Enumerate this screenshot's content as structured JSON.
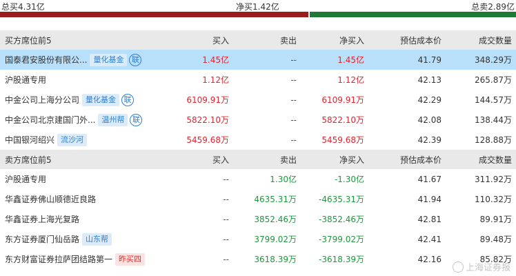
{
  "summary": {
    "total_buy": "总买4.31亿",
    "net_buy": "净买1.42亿",
    "total_sell": "总卖2.89亿",
    "buy_share": 0.598,
    "colors": {
      "buy": "#9b1c1c",
      "sell": "#1e7a36"
    }
  },
  "buy_section": {
    "headers": [
      "买方席位前5",
      "买入",
      "卖出",
      "净买入",
      "预估成本价",
      "成交数量"
    ],
    "rows": [
      {
        "name": "国泰君安股份有限公...",
        "tag": "量化基金",
        "lian": "联",
        "buy": "1.45亿",
        "sell": "--",
        "net": "1.45亿",
        "cost": "41.79",
        "volume": "348.29万"
      },
      {
        "name": "沪股通专用",
        "tag": "",
        "lian": "",
        "buy": "1.12亿",
        "sell": "--",
        "net": "1.12亿",
        "cost": "42.13",
        "volume": "265.87万"
      },
      {
        "name": "中金公司上海分公司",
        "tag": "量化基金",
        "lian": "联",
        "buy": "6109.91万",
        "sell": "--",
        "net": "6109.91万",
        "cost": "42.29",
        "volume": "144.57万"
      },
      {
        "name": "中金公司北京建国门外...",
        "tag": "温州帮",
        "lian": "联",
        "buy": "5822.10万",
        "sell": "--",
        "net": "5822.10万",
        "cost": "42.08",
        "volume": "138.44万"
      },
      {
        "name": "中国银河绍兴",
        "tag": "流沙河",
        "lian": "",
        "buy": "5459.68万",
        "sell": "--",
        "net": "5459.68万",
        "cost": "42.39",
        "volume": "128.88万"
      }
    ]
  },
  "sell_section": {
    "headers": [
      "卖方席位前5",
      "买入",
      "卖出",
      "净买入",
      "预估成本价",
      "成交数量"
    ],
    "rows": [
      {
        "name": "沪股通专用",
        "tag": "",
        "buy": "--",
        "sell": "1.30亿",
        "net": "-1.30亿",
        "cost": "41.67",
        "volume": "311.92万"
      },
      {
        "name": "华鑫证券佛山顺德近良路",
        "tag": "",
        "buy": "--",
        "sell": "4635.31万",
        "net": "-4635.31万",
        "cost": "41.94",
        "volume": "110.32万"
      },
      {
        "name": "华鑫证券上海光复路",
        "tag": "",
        "buy": "--",
        "sell": "3852.46万",
        "net": "-3852.46万",
        "cost": "42.81",
        "volume": "89.91万"
      },
      {
        "name": "东方证券厦门仙岳路",
        "tag": "山东帮",
        "buy": "--",
        "sell": "3799.02万",
        "net": "-3799.02万",
        "cost": "42.41",
        "volume": "89.48万"
      },
      {
        "name": "东方财富证券拉萨团结路第一",
        "tag": "昨买四",
        "tag_style": "red",
        "buy": "--",
        "sell": "3618.39万",
        "net": "-3618.39万",
        "cost": "42.16",
        "volume": "85.82万"
      }
    ]
  },
  "watermark": "上海证券报"
}
